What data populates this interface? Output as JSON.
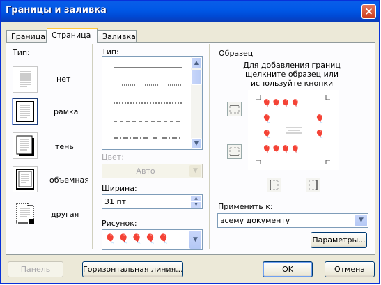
{
  "window": {
    "title": "Границы и заливка",
    "close_glyph": "×"
  },
  "tabs": [
    {
      "label": "Граница"
    },
    {
      "label": "Страница"
    },
    {
      "label": "Заливка"
    }
  ],
  "type_section": {
    "label": "Тип:",
    "presets": [
      {
        "label": "нет"
      },
      {
        "label": "рамка"
      },
      {
        "label": "тень"
      },
      {
        "label": "объемная"
      },
      {
        "label": "другая"
      }
    ]
  },
  "style_section": {
    "type_label": "Тип:",
    "color_label": "Цвет:",
    "color_value": "Авто",
    "width_label": "Ширина:",
    "width_value": "31 пт",
    "art_label": "Рисунок:"
  },
  "preview_section": {
    "title": "Образец",
    "hint": "Для добавления границ щелкните образец или используйте кнопки",
    "apply_label": "Применить к:",
    "apply_value": "всему документу",
    "options_button": "Параметры..."
  },
  "footer": {
    "panel_button": "Панель",
    "hline_button": "Горизонтальная линия...",
    "ok_button": "OK",
    "cancel_button": "Отмена"
  },
  "colors": {
    "titlebar": "#0058e6",
    "dialog_bg": "#ece9d8",
    "tab_highlight": "#ffc83c"
  },
  "icons": {
    "art_motif": "balloon-bunch-icon"
  }
}
